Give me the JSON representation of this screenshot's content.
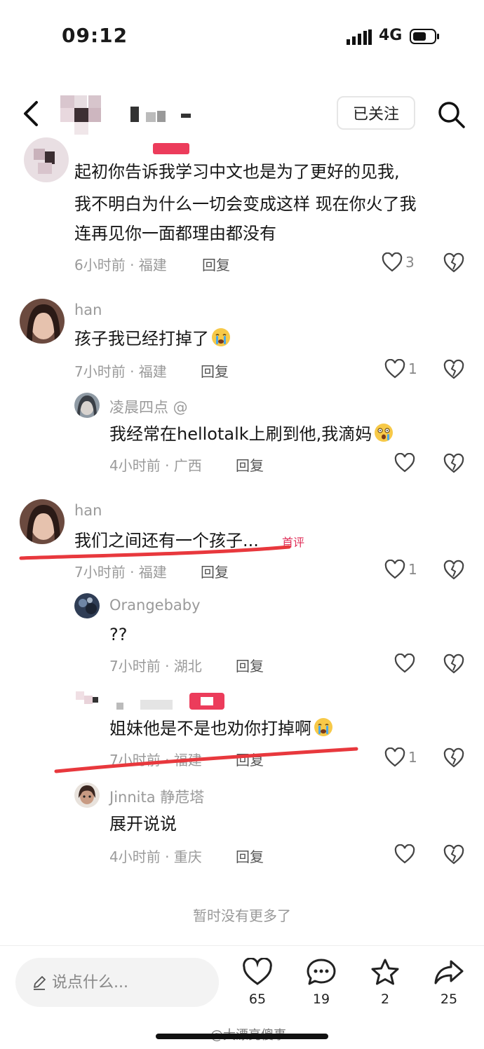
{
  "status_bar": {
    "time": "09:12",
    "network": "4G"
  },
  "header": {
    "follow_label": "已关注"
  },
  "comments": [
    {
      "text_lines": [
        "起初你告诉我学习中文也是为了更好的见我,",
        "我不明白为什么一切会变成这样 现在你火了我",
        "连再见你一面都理由都没有"
      ],
      "meta": "6小时前 · 福建",
      "reply": "回复",
      "likes": "3"
    },
    {
      "user": "han",
      "text": "孩子我已经打掉了",
      "meta": "7小时前 · 福建",
      "reply": "回复",
      "likes": "1",
      "replies": [
        {
          "user": "凌晨四点 @",
          "text": "我经常在hellotalk上刷到他,我滴妈",
          "meta": "4小时前 · 广西",
          "reply": "回复",
          "likes": ""
        }
      ]
    },
    {
      "user": "han",
      "text": "我们之间还有一个孩子...",
      "badge": "首评",
      "meta": "7小时前 · 福建",
      "reply": "回复",
      "likes": "1",
      "replies": [
        {
          "user": "Orangebaby",
          "text": "??",
          "meta": "7小时前 · 湖北",
          "reply": "回复",
          "likes": ""
        },
        {
          "text": "姐妹他是不是也劝你打掉啊",
          "meta": "7小时前 · 福建",
          "reply": "回复",
          "likes": "1"
        },
        {
          "user": "Jinnita 静苊塔",
          "text": "展开说说",
          "meta": "4小时前 · 重庆",
          "reply": "回复",
          "likes": ""
        }
      ]
    }
  ],
  "no_more": "暂时没有更多了",
  "bottom_bar": {
    "input_placeholder": "说点什么...",
    "likes": "65",
    "comments": "19",
    "favorites": "2",
    "shares": "25"
  },
  "watermark": "@大漂亮傻事",
  "colors": {
    "accent": "#ec3c5b",
    "underline": "#e8383d"
  }
}
